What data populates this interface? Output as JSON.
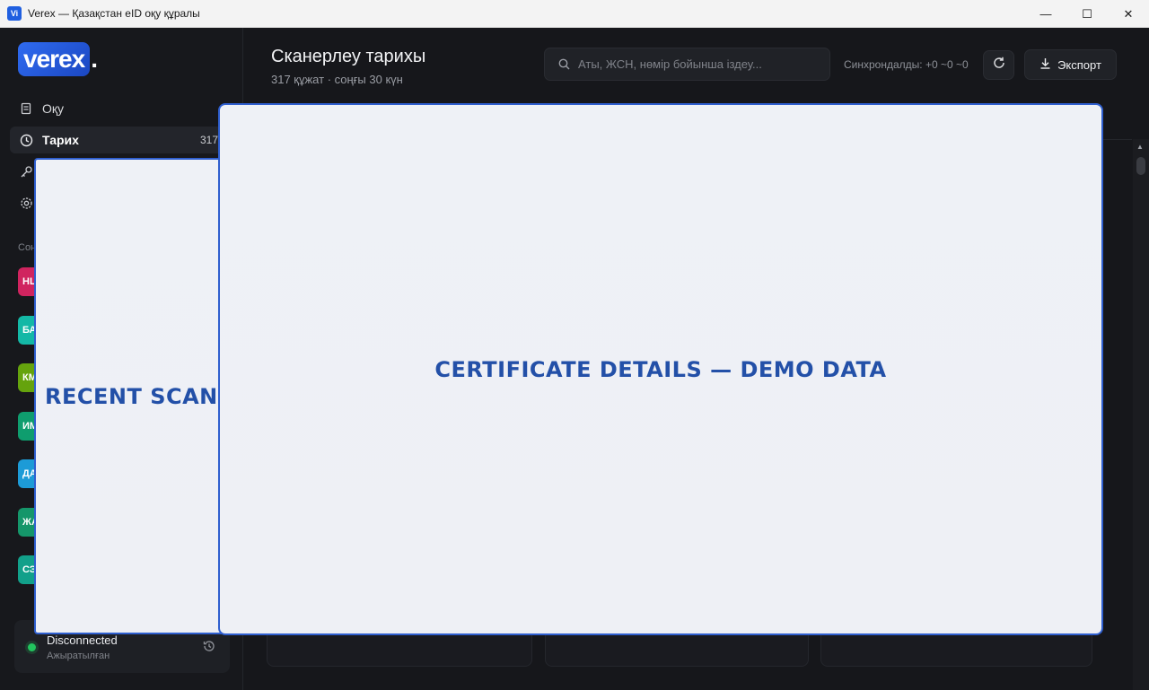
{
  "window": {
    "app_icon_text": "Vi",
    "title": "Verex — Қазақстан eID оқу құралы",
    "controls": {
      "minimize": "—",
      "maximize": "☐",
      "close": "✕"
    }
  },
  "sidebar": {
    "logo_text": "verex",
    "logo_dot": ".",
    "nav": [
      {
        "label": "Оқу",
        "icon": "reader-icon"
      },
      {
        "label": "Тарих",
        "icon": "clock-icon",
        "count": "317",
        "active": true
      },
      {
        "label": "",
        "icon": "key-icon"
      },
      {
        "label": "",
        "icon": "gear-icon"
      }
    ],
    "section_label": "Соң",
    "recent_chips": [
      {
        "text": "НЦ",
        "color": "#d0245f"
      },
      {
        "text": "БА",
        "color": "#14b8a6"
      },
      {
        "text": "КМ",
        "color": "#65a30d"
      },
      {
        "text": "ИМ",
        "color": "#0f9d6e"
      },
      {
        "text": "ДА",
        "color": "#1d9bd7"
      },
      {
        "text": "ЖА",
        "color": "#15966a"
      },
      {
        "text": "СЭ",
        "color": "#12a08a"
      }
    ],
    "status": {
      "title": "Disconnected",
      "subtitle": "Ажыратылған",
      "dot_color": "#22c55e"
    }
  },
  "header": {
    "title": "Сканерлеу тарихы",
    "subtitle": "317 құжат · соңғы 30 күн",
    "search_placeholder": "Аты, ЖСН, нөмір бойынша іздеу...",
    "sync_text": "Синхрондалды: +0 ~0 ~0",
    "export_label": "Экспорт"
  },
  "overlays": {
    "left_title": "RECENT SCANS",
    "right_title": "CERTIFICATE DETAILS — DEMO DATA"
  }
}
